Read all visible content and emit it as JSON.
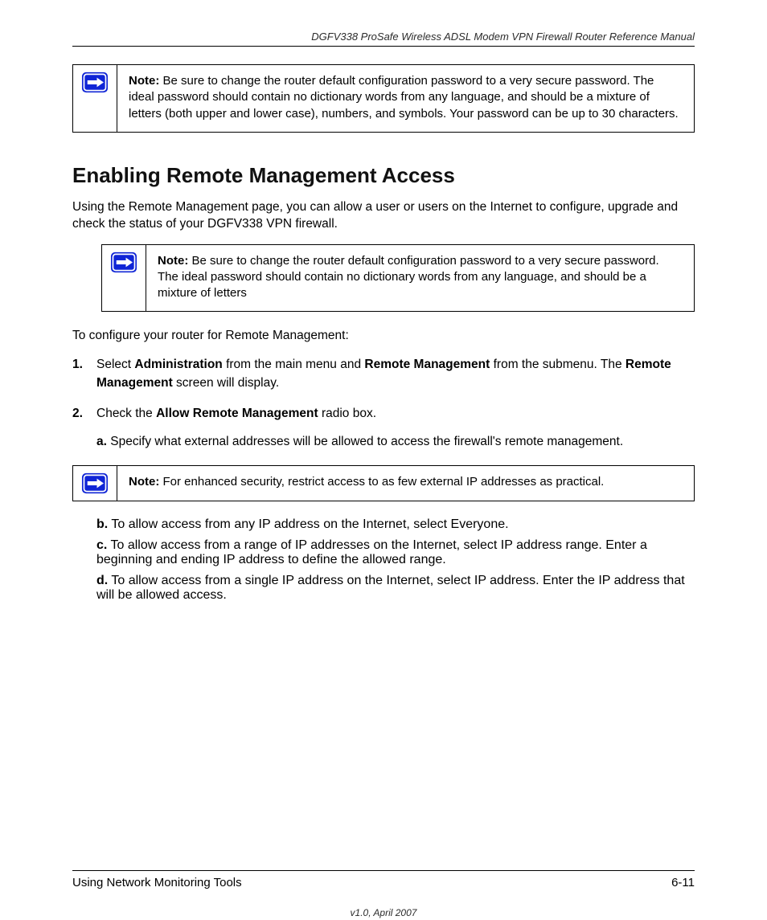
{
  "header": {
    "running": "DGFV338 ProSafe Wireless ADSL Modem VPN Firewall Router Reference Manual"
  },
  "note1": {
    "label": "Note:",
    "text": " Be sure to change the router default configuration password to a very secure password. The ideal password should contain no dictionary words from any language, and should be a mixture of letters (both upper and lower case), numbers, and symbols. Your password can be up to 30 characters."
  },
  "section_title": "Enabling Remote Management Access",
  "para1": "Using the Remote Management page, you can allow a user or users on the Internet to configure, upgrade and check the status of your DGFV338 VPN firewall.",
  "note2": {
    "label": "Note:",
    "text": " Be sure to change the router default configuration password to a very secure password. The ideal password should contain no dictionary words from any language, and should be a mixture of letters"
  },
  "steps_intro": "To configure your router for Remote Management:",
  "steps": [
    {
      "num": "1.",
      "lead": "Select ",
      "ui1": "Administration",
      "mid1": " from the main menu and ",
      "ui2": "Remote Management",
      "mid2": " from the submenu. The ",
      "ui3": "Remote Management",
      "tail": " screen will display."
    },
    {
      "num": "2.",
      "pre": "Check the ",
      "ui": "Allow Remote Management",
      "post": " radio box.",
      "sub_a": {
        "bold": "a.",
        "text": "   Specify what external addresses will be allowed to access the firewall's remote management."
      }
    }
  ],
  "note3": {
    "label": "Note:",
    "text": " For enhanced security, restrict access to as few external IP addresses as practical."
  },
  "steps2": [
    {
      "bold": "b.",
      "text": "   To allow access from any IP address on the Internet, select Everyone."
    },
    {
      "bold": "c.",
      "text": "   To allow access from a range of IP addresses on the Internet, select IP address range. Enter a beginning and ending IP address to define the allowed range."
    },
    {
      "bold": "d.",
      "text": "   To allow access from a single IP address on the Internet, select IP address. Enter the IP address that will be allowed access."
    }
  ],
  "footer": {
    "left": "Using Network Monitoring Tools",
    "right": "6-11",
    "meta": "v1.0, April 2007"
  }
}
